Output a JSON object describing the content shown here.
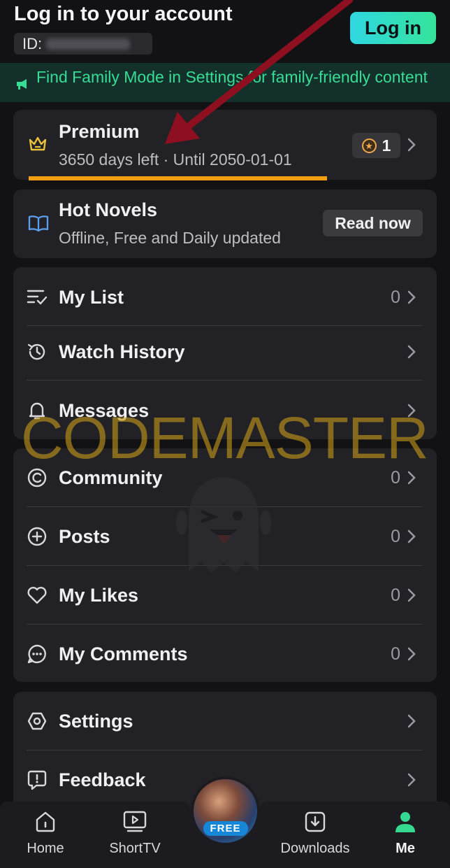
{
  "header": {
    "title": "Log in to your account",
    "id_label": "ID:",
    "login_button": "Log in"
  },
  "banner": {
    "text": "Find Family Mode in Settings for family-friendly content",
    "icon": "megaphone-icon",
    "color": "#37dd95"
  },
  "premium": {
    "title": "Premium",
    "subtitle": "3650 days left · Until 2050-01-01",
    "points": "1",
    "icon": "crown-icon",
    "highlight_color": "#f0a010"
  },
  "novels": {
    "title": "Hot Novels",
    "subtitle": "Offline, Free and Daily updated",
    "button": "Read now",
    "icon": "book-icon"
  },
  "list_group": [
    {
      "label": "My List",
      "count": "0",
      "icon": "list-check-icon"
    },
    {
      "label": "Watch History",
      "count": "",
      "icon": "history-icon"
    },
    {
      "label": "Messages",
      "count": "",
      "icon": "bell-icon"
    }
  ],
  "community_group": [
    {
      "label": "Community",
      "count": "0",
      "icon": "community-icon"
    },
    {
      "label": "Posts",
      "count": "0",
      "icon": "plus-circle-icon"
    },
    {
      "label": "My Likes",
      "count": "0",
      "icon": "heart-icon"
    },
    {
      "label": "My Comments",
      "count": "0",
      "icon": "comment-icon"
    }
  ],
  "settings_group": [
    {
      "label": "Settings",
      "icon": "settings-icon"
    },
    {
      "label": "Feedback",
      "icon": "feedback-icon"
    }
  ],
  "watermark": "CODEMASTER",
  "nav": {
    "home": "Home",
    "shorttv": "ShortTV",
    "free": "FREE",
    "downloads": "Downloads",
    "me": "Me",
    "active": "Me",
    "active_color": "#35d98f"
  }
}
